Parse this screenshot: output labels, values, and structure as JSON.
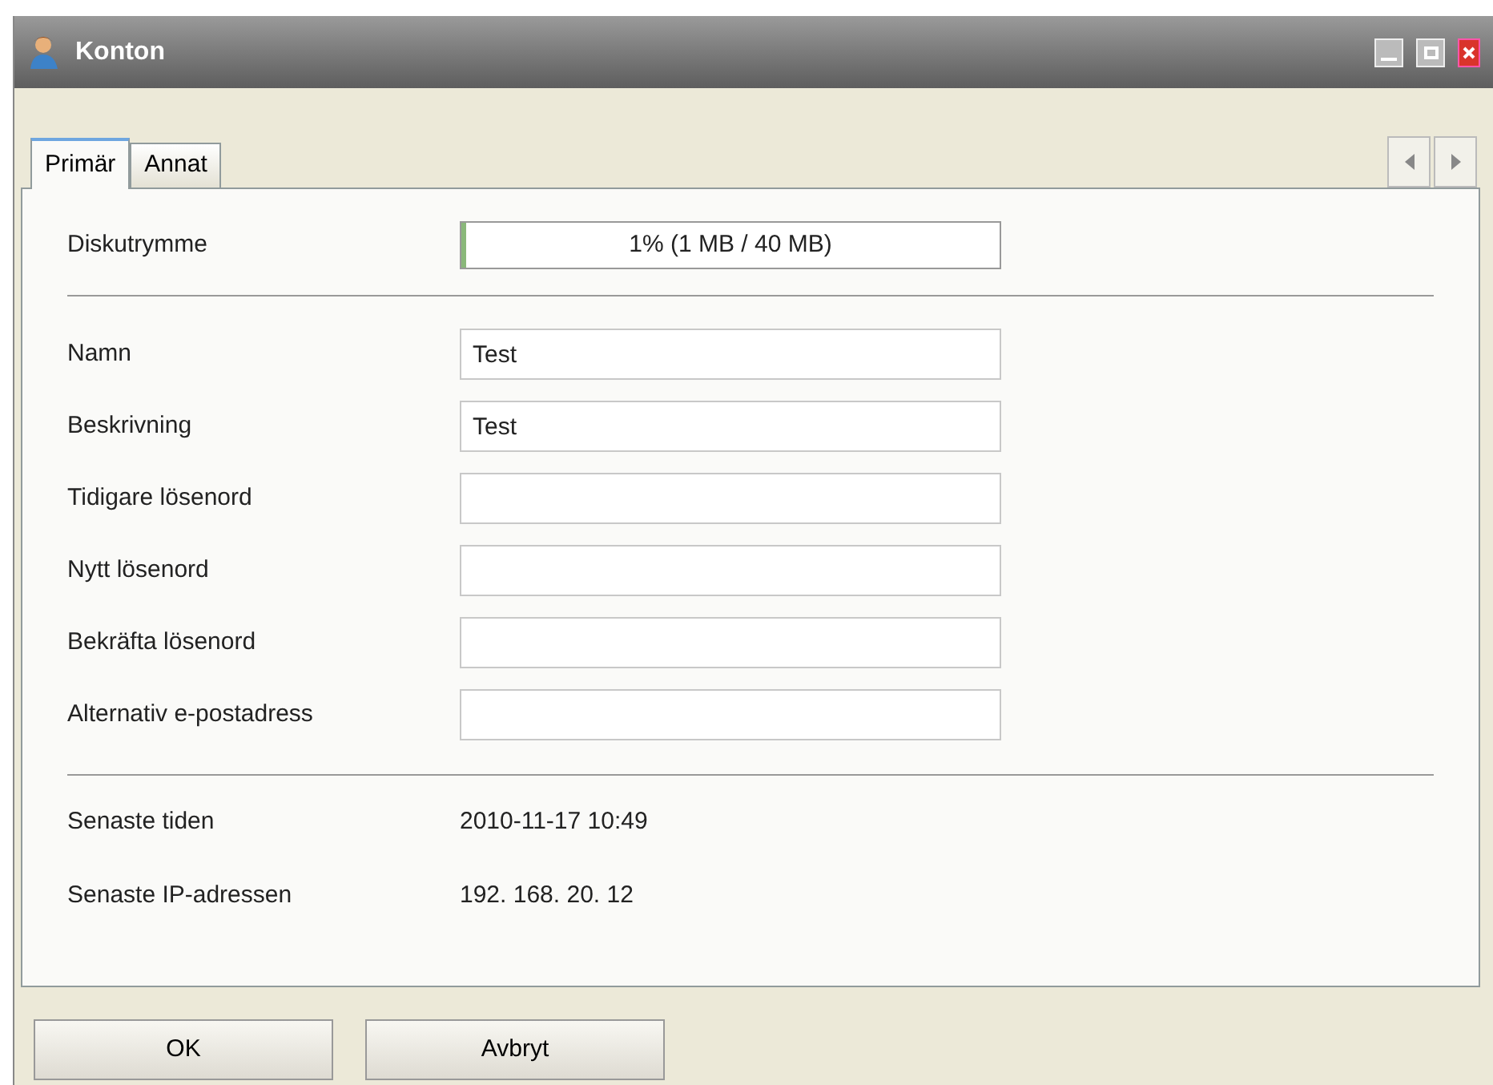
{
  "window": {
    "title": "Konton"
  },
  "tabs": [
    {
      "label": "Primär",
      "selected": true
    },
    {
      "label": "Annat",
      "selected": false
    }
  ],
  "disk": {
    "label": "Diskutrymme",
    "level": 0.01,
    "reading": "1% (1 MB / 40 MB)"
  },
  "fields": [
    {
      "label": "Namn",
      "value": "Test"
    },
    {
      "label": "Beskrivning",
      "value": "Test"
    },
    {
      "label": "Tidigare lösenord"
    },
    {
      "label": "Nytt lösenord"
    },
    {
      "label": "Bekräfta lösenord"
    },
    {
      "label": "Alternativ e-postadress"
    }
  ],
  "info": [
    {
      "label": "Senaste tiden",
      "value": "2010-11-17 10:49"
    },
    {
      "label": "Senaste IP-adressen",
      "value": "192. 168. 20. 12"
    }
  ],
  "buttons": [
    "OK",
    "Avbryt"
  ]
}
